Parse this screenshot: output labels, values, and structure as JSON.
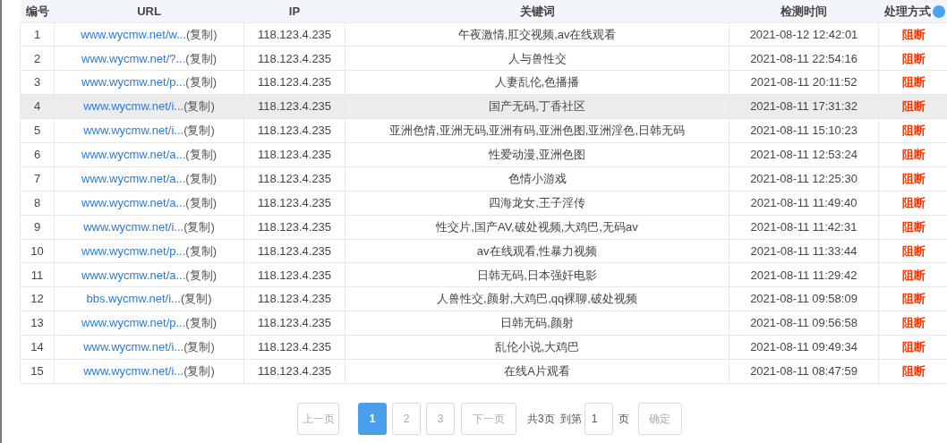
{
  "table": {
    "columns": [
      "编号",
      "URL",
      "IP",
      "关键词",
      "检测时间",
      "处理方式"
    ],
    "rows": [
      {
        "no": "1",
        "url": "www.wycmw.net/w...",
        "copy": "(复制)",
        "ip": "118.123.4.235",
        "keywords": "午夜激情,肛交视频,av在线观看",
        "time": "2021-08-12 12:42:01",
        "action": "阻断",
        "highlighted": false
      },
      {
        "no": "2",
        "url": "www.wycmw.net/?...",
        "copy": "(复制)",
        "ip": "118.123.4.235",
        "keywords": "人与兽性交",
        "time": "2021-08-11 22:54:16",
        "action": "阻断",
        "highlighted": false
      },
      {
        "no": "3",
        "url": "www.wycmw.net/p...",
        "copy": "(复制)",
        "ip": "118.123.4.235",
        "keywords": "人妻乱伦,色播播",
        "time": "2021-08-11 20:11:52",
        "action": "阻断",
        "highlighted": false
      },
      {
        "no": "4",
        "url": "www.wycmw.net/i...",
        "copy": "(复制)",
        "ip": "118.123.4.235",
        "keywords": "国产无码,丁香社区",
        "time": "2021-08-11 17:31:32",
        "action": "阻断",
        "highlighted": true
      },
      {
        "no": "5",
        "url": "www.wycmw.net/i...",
        "copy": "(复制)",
        "ip": "118.123.4.235",
        "keywords": "亚洲色情,亚洲无码,亚洲有码,亚洲色图,亚洲淫色,日韩无码",
        "time": "2021-08-11 15:10:23",
        "action": "阻断",
        "highlighted": false
      },
      {
        "no": "6",
        "url": "www.wycmw.net/a...",
        "copy": "(复制)",
        "ip": "118.123.4.235",
        "keywords": "性爱动漫,亚洲色图",
        "time": "2021-08-11 12:53:24",
        "action": "阻断",
        "highlighted": false
      },
      {
        "no": "7",
        "url": "www.wycmw.net/a...",
        "copy": "(复制)",
        "ip": "118.123.4.235",
        "keywords": "色情小游戏",
        "time": "2021-08-11 12:25:30",
        "action": "阻断",
        "highlighted": false
      },
      {
        "no": "8",
        "url": "www.wycmw.net/a...",
        "copy": "(复制)",
        "ip": "118.123.4.235",
        "keywords": "四海龙女,王子淫传",
        "time": "2021-08-11 11:49:40",
        "action": "阻断",
        "highlighted": false
      },
      {
        "no": "9",
        "url": "www.wycmw.net/i...",
        "copy": "(复制)",
        "ip": "118.123.4.235",
        "keywords": "性交片,国产AV,破处视频,大鸡巴,无码av",
        "time": "2021-08-11 11:42:31",
        "action": "阻断",
        "highlighted": false
      },
      {
        "no": "10",
        "url": "www.wycmw.net/p...",
        "copy": "(复制)",
        "ip": "118.123.4.235",
        "keywords": "av在线观看,性暴力视频",
        "time": "2021-08-11 11:33:44",
        "action": "阻断",
        "highlighted": false
      },
      {
        "no": "11",
        "url": "www.wycmw.net/a...",
        "copy": "(复制)",
        "ip": "118.123.4.235",
        "keywords": "日韩无码,日本强奸电影",
        "time": "2021-08-11 11:29:42",
        "action": "阻断",
        "highlighted": false
      },
      {
        "no": "12",
        "url": "bbs.wycmw.net/i...",
        "copy": "(复制)",
        "ip": "118.123.4.235",
        "keywords": "人兽性交,颜射,大鸡巴,qq裸聊,破处视频",
        "time": "2021-08-11 09:58:09",
        "action": "阻断",
        "highlighted": false
      },
      {
        "no": "13",
        "url": "www.wycmw.net/p...",
        "copy": "(复制)",
        "ip": "118.123.4.235",
        "keywords": "日韩无码,颜射",
        "time": "2021-08-11 09:56:58",
        "action": "阻断",
        "highlighted": false
      },
      {
        "no": "14",
        "url": "www.wycmw.net/i...",
        "copy": "(复制)",
        "ip": "118.123.4.235",
        "keywords": "乱伦小说,大鸡巴",
        "time": "2021-08-11 09:49:34",
        "action": "阻断",
        "highlighted": false
      },
      {
        "no": "15",
        "url": "www.wycmw.net/i...",
        "copy": "(复制)",
        "ip": "118.123.4.235",
        "keywords": "在线A片观看",
        "time": "2021-08-11 08:47:59",
        "action": "阻断",
        "highlighted": false
      }
    ]
  },
  "pagination": {
    "prev": "上一页",
    "pages": [
      {
        "label": "1",
        "selected": true
      },
      {
        "label": "2",
        "selected": false
      },
      {
        "label": "3",
        "selected": false
      }
    ],
    "next": "下一页",
    "total": "共3页",
    "goto": "到第",
    "page_input": "1",
    "page_suffix": "页",
    "confirm": "确定"
  }
}
